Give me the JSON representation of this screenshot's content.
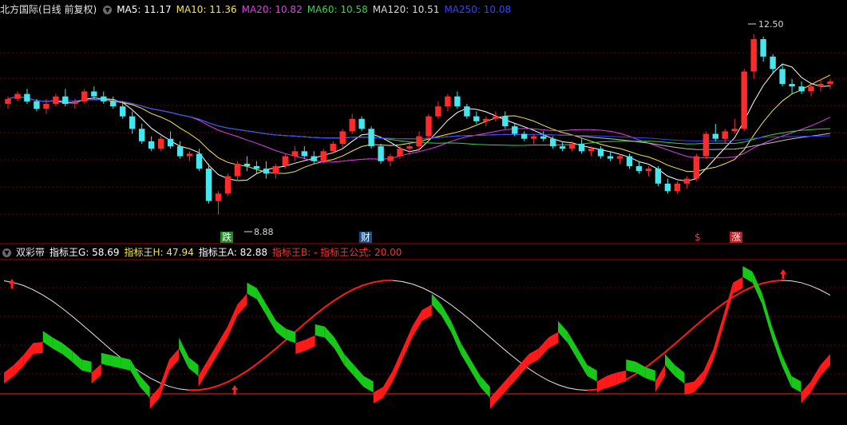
{
  "top_header": {
    "title": "北方国际(日线 前复权)",
    "menu_icon": "chevron-down-icon",
    "ma": [
      {
        "label": "MA5: 11.17",
        "color": "#ffffff"
      },
      {
        "label": "MA10: 11.36",
        "color": "#f6e74a"
      },
      {
        "label": "MA20: 10.82",
        "color": "#e040e8"
      },
      {
        "label": "MA60: 10.58",
        "color": "#39d449"
      },
      {
        "label": "MA120: 10.51",
        "color": "#d8d8d8"
      },
      {
        "label": "MA250: 10.08",
        "color": "#3444ff"
      }
    ]
  },
  "price_annotations": {
    "high": "12.50",
    "low": "8.88"
  },
  "event_markers": [
    {
      "label": "跌",
      "bg": "#1d8a25",
      "fg": "#ffffff"
    },
    {
      "label": "财",
      "bg": "#1c4f8a",
      "fg": "#ffffff"
    },
    {
      "label": "$",
      "bg": "#000000",
      "fg": "#ff3030"
    },
    {
      "label": "涨",
      "bg": "#b32025",
      "fg": "#ffffff"
    }
  ],
  "indicator_header": {
    "name": "双彩带",
    "menu_icon": "chevron-down-icon",
    "values": [
      {
        "label": "指标王G: 58.69",
        "color": "#ffffff"
      },
      {
        "label": "指标王H: 47.94",
        "color": "#f6e74a"
      },
      {
        "label": "指标王A: 82.88",
        "color": "#ffffff"
      },
      {
        "label": "指标王B: - 指标王公式: 20.00",
        "color": "#ff3030"
      }
    ]
  },
  "colors": {
    "up": "#ff2a2a",
    "down": "#45e6ee",
    "grid": "#7a0000",
    "ribbon_up": "#ff1a1a",
    "ribbon_down": "#18c818"
  },
  "candles": [
    [
      11.1,
      11.25,
      11.0,
      11.2
    ],
    [
      11.2,
      11.35,
      11.15,
      11.3
    ],
    [
      11.3,
      11.4,
      11.1,
      11.15
    ],
    [
      11.15,
      11.2,
      10.95,
      11.0
    ],
    [
      11.0,
      11.2,
      10.9,
      11.1
    ],
    [
      11.1,
      11.3,
      11.05,
      11.25
    ],
    [
      11.25,
      11.4,
      11.05,
      11.1
    ],
    [
      11.1,
      11.2,
      11.0,
      11.15
    ],
    [
      11.15,
      11.4,
      11.1,
      11.35
    ],
    [
      11.35,
      11.45,
      11.2,
      11.25
    ],
    [
      11.25,
      11.35,
      11.1,
      11.15
    ],
    [
      11.15,
      11.25,
      11.0,
      11.05
    ],
    [
      11.05,
      11.15,
      10.8,
      10.85
    ],
    [
      10.85,
      10.95,
      10.5,
      10.6
    ],
    [
      10.6,
      10.7,
      10.3,
      10.35
    ],
    [
      10.35,
      10.45,
      10.15,
      10.2
    ],
    [
      10.2,
      10.45,
      10.15,
      10.4
    ],
    [
      10.4,
      10.55,
      10.2,
      10.25
    ],
    [
      10.25,
      10.35,
      10.0,
      10.05
    ],
    [
      10.05,
      10.15,
      9.95,
      10.1
    ],
    [
      10.1,
      10.2,
      9.75,
      9.8
    ],
    [
      9.8,
      9.9,
      9.1,
      9.15
    ],
    [
      9.15,
      9.35,
      8.88,
      9.3
    ],
    [
      9.3,
      9.7,
      9.25,
      9.65
    ],
    [
      9.65,
      9.95,
      9.55,
      9.9
    ],
    [
      9.9,
      10.05,
      9.75,
      9.85
    ],
    [
      9.85,
      9.95,
      9.7,
      9.8
    ],
    [
      9.8,
      9.95,
      9.6,
      9.7
    ],
    [
      9.7,
      9.9,
      9.6,
      9.85
    ],
    [
      9.85,
      10.1,
      9.8,
      10.05
    ],
    [
      10.05,
      10.25,
      9.95,
      10.15
    ],
    [
      10.15,
      10.25,
      10.0,
      10.05
    ],
    [
      10.05,
      10.15,
      9.9,
      9.95
    ],
    [
      9.95,
      10.2,
      9.9,
      10.15
    ],
    [
      10.15,
      10.35,
      10.1,
      10.3
    ],
    [
      10.3,
      10.6,
      10.2,
      10.55
    ],
    [
      10.55,
      10.9,
      10.5,
      10.8
    ],
    [
      10.8,
      10.85,
      10.55,
      10.6
    ],
    [
      10.6,
      10.65,
      10.2,
      10.25
    ],
    [
      10.25,
      10.3,
      9.9,
      9.95
    ],
    [
      9.95,
      10.1,
      9.85,
      10.05
    ],
    [
      10.05,
      10.25,
      10.0,
      10.2
    ],
    [
      10.2,
      10.3,
      10.1,
      10.25
    ],
    [
      10.25,
      10.55,
      10.15,
      10.45
    ],
    [
      10.45,
      10.9,
      10.4,
      10.85
    ],
    [
      10.85,
      11.15,
      10.8,
      11.05
    ],
    [
      11.05,
      11.3,
      10.95,
      11.25
    ],
    [
      11.25,
      11.35,
      11.0,
      11.05
    ],
    [
      11.05,
      11.1,
      10.8,
      10.85
    ],
    [
      10.85,
      10.95,
      10.7,
      10.75
    ],
    [
      10.75,
      10.85,
      10.65,
      10.8
    ],
    [
      10.8,
      10.95,
      10.75,
      10.85
    ],
    [
      10.85,
      10.95,
      10.6,
      10.65
    ],
    [
      10.65,
      10.7,
      10.45,
      10.5
    ],
    [
      10.5,
      10.55,
      10.35,
      10.4
    ],
    [
      10.4,
      10.5,
      10.3,
      10.45
    ],
    [
      10.45,
      10.55,
      10.35,
      10.4
    ],
    [
      10.4,
      10.45,
      10.2,
      10.25
    ],
    [
      10.25,
      10.35,
      10.15,
      10.2
    ],
    [
      10.2,
      10.35,
      10.15,
      10.3
    ],
    [
      10.3,
      10.4,
      10.1,
      10.15
    ],
    [
      10.15,
      10.25,
      10.05,
      10.2
    ],
    [
      10.2,
      10.25,
      10.0,
      10.05
    ],
    [
      10.05,
      10.15,
      9.95,
      10.0
    ],
    [
      10.0,
      10.1,
      9.9,
      10.05
    ],
    [
      10.05,
      10.1,
      9.8,
      9.85
    ],
    [
      9.85,
      9.95,
      9.7,
      9.75
    ],
    [
      9.75,
      9.85,
      9.65,
      9.8
    ],
    [
      9.8,
      9.85,
      9.45,
      9.5
    ],
    [
      9.5,
      9.6,
      9.3,
      9.35
    ],
    [
      9.35,
      9.55,
      9.3,
      9.5
    ],
    [
      9.5,
      9.65,
      9.4,
      9.6
    ],
    [
      9.6,
      10.1,
      9.55,
      10.05
    ],
    [
      10.05,
      10.55,
      10.0,
      10.5
    ],
    [
      10.5,
      10.7,
      10.35,
      10.4
    ],
    [
      10.4,
      10.6,
      10.3,
      10.55
    ],
    [
      10.55,
      10.8,
      10.5,
      10.6
    ],
    [
      10.6,
      11.8,
      10.55,
      11.75
    ],
    [
      11.75,
      12.5,
      11.6,
      12.4
    ],
    [
      12.4,
      12.45,
      11.95,
      12.05
    ],
    [
      12.05,
      12.1,
      11.7,
      11.8
    ],
    [
      11.8,
      11.9,
      11.45,
      11.5
    ],
    [
      11.5,
      11.6,
      11.3,
      11.45
    ],
    [
      11.45,
      11.55,
      11.3,
      11.35
    ],
    [
      11.35,
      11.5,
      11.25,
      11.45
    ],
    [
      11.45,
      11.6,
      11.35,
      11.5
    ],
    [
      11.5,
      11.6,
      11.4,
      11.55
    ]
  ],
  "ribbon_inner": [
    8,
    15,
    24,
    35,
    36,
    30,
    25,
    18,
    10,
    8,
    16,
    14,
    12,
    10,
    -5,
    -15,
    -5,
    20,
    30,
    12,
    5,
    20,
    35,
    50,
    70,
    80,
    75,
    60,
    45,
    38,
    35,
    38,
    42,
    40,
    30,
    15,
    5,
    -5,
    -10,
    -5,
    10,
    30,
    50,
    65,
    70,
    60,
    45,
    25,
    10,
    -5,
    -15,
    -5,
    5,
    15,
    25,
    30,
    40,
    45,
    35,
    20,
    5,
    0,
    5,
    8,
    10,
    8,
    3,
    0,
    15,
    5,
    -2,
    0,
    10,
    30,
    60,
    90,
    95,
    90,
    70,
    40,
    15,
    -5,
    -10,
    0,
    15,
    25
  ]
}
